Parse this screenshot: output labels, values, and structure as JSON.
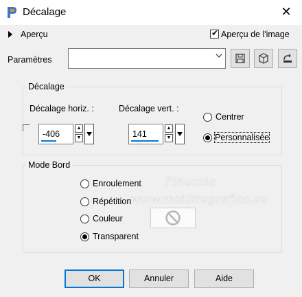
{
  "window": {
    "title": "Décalage",
    "close_glyph": "✕",
    "app_icon": "paintshop-pro-icon"
  },
  "preview": {
    "toggle_label": "Aperçu",
    "image_preview_label": "Aperçu de l'image",
    "image_preview_checked": true
  },
  "presets": {
    "label": "Paramètres",
    "value": "",
    "tool_icons": [
      "save-preset-icon",
      "reset-default-icon",
      "edit-presets-icon"
    ]
  },
  "offset": {
    "group_title": "Décalage",
    "horizontal_label": "Décalage horiz. :",
    "horizontal_value": "-406",
    "vertical_label": "Décalage vert. :",
    "vertical_value": "141",
    "options": [
      {
        "label": "Centrer",
        "selected": false
      },
      {
        "label": "Personnalisée",
        "selected": true
      }
    ]
  },
  "edge_mode": {
    "group_title": "Mode Bord",
    "options": [
      {
        "label": "Enroulement",
        "selected": false
      },
      {
        "label": "Répétition",
        "selected": false
      },
      {
        "label": "Couleur",
        "selected": false
      },
      {
        "label": "Transparent",
        "selected": true
      }
    ],
    "color_swatch_icon": "no-symbol-icon"
  },
  "watermark": {
    "line1": "Pinuccia",
    "line2": "www.maidiregrafica.eu"
  },
  "buttons": {
    "ok": "OK",
    "cancel": "Annuler",
    "help": "Aide"
  }
}
